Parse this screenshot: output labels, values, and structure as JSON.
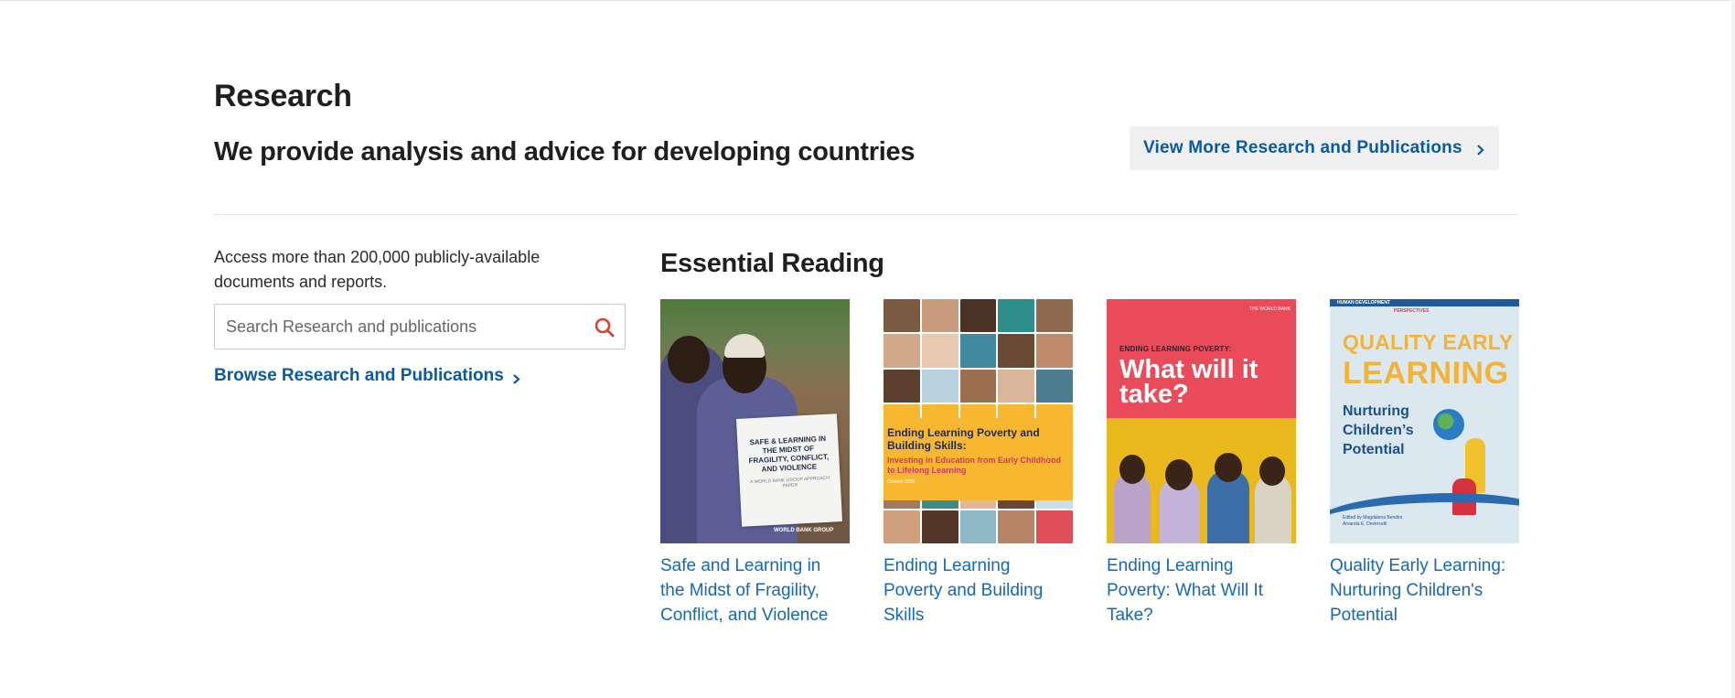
{
  "section": {
    "title": "Research",
    "subtitle": "We provide analysis and advice for developing countries",
    "view_more_label": "View More Research and Publications"
  },
  "sidebar": {
    "access_text": "Access more than 200,000 publicly-available documents and reports.",
    "search_placeholder": "Search Research and publications",
    "browse_label": "Browse Research and Publications"
  },
  "essential": {
    "title": "Essential Reading",
    "items": [
      {
        "caption": "Safe and Learning in the Midst of Fragility, Conflict, and Violence",
        "cover_title": "SAFE & LEARNING IN THE MIDST OF FRAGILITY, CONFLICT, AND VIOLENCE",
        "cover_sub": "A WORLD BANK GROUP APPROACH PAPER",
        "cover_brand": "WORLD BANK GROUP"
      },
      {
        "caption": "Ending Learning Poverty and Building Skills",
        "cover_title": "Ending Learning Poverty and Building Skills:",
        "cover_sub": "Investing in Education from Early Childhood to Lifelong Learning",
        "cover_date": "October 2022"
      },
      {
        "caption": "Ending Learning Poverty: What Will It Take?",
        "cover_kicker": "ENDING LEARNING POVERTY:",
        "cover_title": "What will it take?",
        "cover_brand": "THE WORLD BANK"
      },
      {
        "caption": "Quality Early Learning: Nurturing Children's Potential",
        "cover_series": "HUMAN DEVELOPMENT",
        "cover_persp": "PERSPECTIVES",
        "cover_line1": "QUALITY EARLY",
        "cover_line2": "LEARNING",
        "cover_sub": "Nurturing Children’s Potential",
        "cover_editors": "Edited by Magdalena Bendini Amanda E. Devercelli"
      }
    ]
  },
  "colors": {
    "link": "#1867b4",
    "accent_link": "#0a5aa3",
    "search_icon": "#d64533",
    "button_bg": "#f0f0f0"
  },
  "icons": {
    "search": "search-icon",
    "chevron": "chevron-right-icon"
  }
}
